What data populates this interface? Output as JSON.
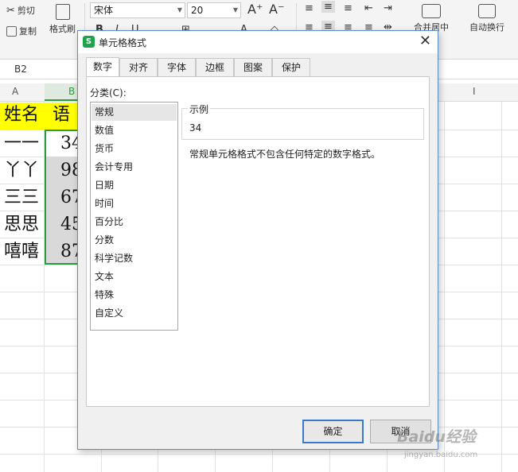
{
  "ribbon": {
    "cut": "剪切",
    "copy": "复制",
    "format_painter": "格式刷",
    "font_name": "宋体",
    "font_size": "20",
    "merge_center": "合并居中",
    "wrap_text": "自动换行"
  },
  "formula_bar": {
    "name_box": "B2"
  },
  "columns": [
    "A",
    "B",
    "I"
  ],
  "sheet": {
    "header_a": "姓名",
    "header_b": "语",
    "rows": [
      {
        "name": "一一",
        "val": "34"
      },
      {
        "name": "丫丫",
        "val": "98"
      },
      {
        "name": "三三",
        "val": "67"
      },
      {
        "name": "思思",
        "val": "45"
      },
      {
        "name": "嘻嘻",
        "val": "87"
      }
    ]
  },
  "dialog": {
    "title": "单元格格式",
    "tabs": [
      "数字",
      "对齐",
      "字体",
      "边框",
      "图案",
      "保护"
    ],
    "category_label": "分类(C):",
    "categories": [
      "常规",
      "数值",
      "货币",
      "会计专用",
      "日期",
      "时间",
      "百分比",
      "分数",
      "科学记数",
      "文本",
      "特殊",
      "自定义"
    ],
    "sample_label": "示例",
    "sample_value": "34",
    "description": "常规单元格格式不包含任何特定的数字格式。",
    "ok": "确定",
    "cancel": "取消"
  },
  "watermark": {
    "text": "Baidu经验",
    "sub": "jingyan.baidu.com"
  },
  "colors": {
    "accent_green": "#2e9a3e",
    "header_yellow": "#ffff00",
    "dialog_border": "#5b8ec9",
    "primary_button_border": "#3a78c9"
  }
}
